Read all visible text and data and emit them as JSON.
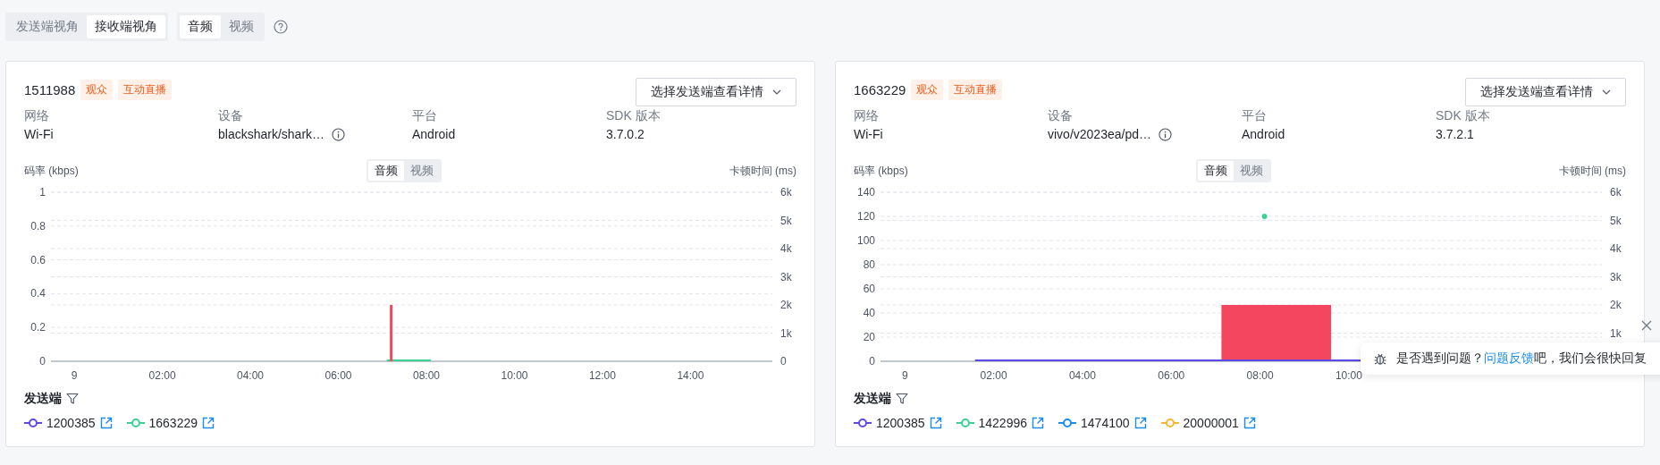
{
  "view_toggle": [
    {
      "label": "发送端视角",
      "selected": false
    },
    {
      "label": "接收端视角",
      "selected": true
    }
  ],
  "media_toggle": [
    {
      "label": "音频",
      "selected": true
    },
    {
      "label": "视频",
      "selected": false
    }
  ],
  "panels": [
    {
      "user_id": "1511988",
      "axis_start_label": "9",
      "tags": [
        "观众",
        "互动直播"
      ],
      "select_button": "选择发送端查看详情",
      "info": [
        {
          "label": "网络",
          "value": "Wi-Fi",
          "info_icon": false
        },
        {
          "label": "设备",
          "value": "blackshark/shark…",
          "info_icon": true
        },
        {
          "label": "平台",
          "value": "Android",
          "info_icon": false
        },
        {
          "label": "SDK 版本",
          "value": "3.7.0.2",
          "info_icon": false
        }
      ],
      "chart_toggle": [
        {
          "label": "音频",
          "selected": true
        },
        {
          "label": "视频",
          "selected": false
        }
      ],
      "chart_data": {
        "type": "line",
        "ylabel": "码率 (kbps)",
        "y2label": "卡顿时间 (ms)",
        "xlim": [
          -0.53,
          15.86
        ],
        "ylim": [
          0,
          1
        ],
        "y2lim": [
          0,
          6000
        ],
        "grid": true,
        "xticks": [
          {
            "value": 2,
            "label": "02:00"
          },
          {
            "value": 4,
            "label": "04:00"
          },
          {
            "value": 6,
            "label": "06:00"
          },
          {
            "value": 8,
            "label": "08:00"
          },
          {
            "value": 10,
            "label": "10:00"
          },
          {
            "value": 12,
            "label": "12:00"
          },
          {
            "value": 14,
            "label": "14:00"
          }
        ],
        "yticks": [
          {
            "value": 0,
            "label": "0"
          },
          {
            "value": 0.2,
            "label": "0.2"
          },
          {
            "value": 0.4,
            "label": "0.4"
          },
          {
            "value": 0.6,
            "label": "0.6"
          },
          {
            "value": 0.8,
            "label": "0.8"
          },
          {
            "value": 1,
            "label": "1"
          }
        ],
        "y2ticks": [
          {
            "value": 0,
            "label": "0"
          },
          {
            "value": 1000,
            "label": "1k"
          },
          {
            "value": 2000,
            "label": "2k"
          },
          {
            "value": 3000,
            "label": "3k"
          },
          {
            "value": 4000,
            "label": "4k"
          },
          {
            "value": 5000,
            "label": "5k"
          },
          {
            "value": 6000,
            "label": "6k"
          }
        ],
        "series": [
          {
            "color": "#3ad394",
            "type": "line",
            "x": [
              7.1,
              8.1
            ],
            "values": [
              0,
              0
            ]
          },
          {
            "color": "#f5465f",
            "type": "area",
            "axis": "y2",
            "x": [
              7.17,
              7.23
            ],
            "values": [
              2000,
              2000
            ]
          }
        ]
      },
      "legend_title": "发送端",
      "legend": [
        {
          "label": "1200385",
          "color": "#5b49e8"
        },
        {
          "label": "1663229",
          "color": "#3ad394"
        }
      ]
    },
    {
      "user_id": "1663229",
      "axis_start_label": "9",
      "tags": [
        "观众",
        "互动直播"
      ],
      "select_button": "选择发送端查看详情",
      "info": [
        {
          "label": "网络",
          "value": "Wi-Fi",
          "info_icon": false
        },
        {
          "label": "设备",
          "value": "vivo/v2023ea/pd…",
          "info_icon": true
        },
        {
          "label": "平台",
          "value": "Android",
          "info_icon": false
        },
        {
          "label": "SDK 版本",
          "value": "3.7.2.1",
          "info_icon": false
        }
      ],
      "chart_toggle": [
        {
          "label": "音频",
          "selected": true
        },
        {
          "label": "视频",
          "selected": false
        }
      ],
      "chart_data": {
        "type": "line",
        "ylabel": "码率 (kbps)",
        "y2label": "卡顿时间 (ms)",
        "xlim": [
          -0.55,
          15.7
        ],
        "ylim": [
          0,
          140
        ],
        "y2lim": [
          0,
          6000
        ],
        "grid": true,
        "xticks": [
          {
            "value": 2,
            "label": "02:00"
          },
          {
            "value": 4,
            "label": "04:00"
          },
          {
            "value": 6,
            "label": "06:00"
          },
          {
            "value": 8,
            "label": "08:00"
          },
          {
            "value": 10,
            "label": "10:00"
          }
        ],
        "yticks": [
          {
            "value": 0,
            "label": "0"
          },
          {
            "value": 20,
            "label": "20"
          },
          {
            "value": 40,
            "label": "40"
          },
          {
            "value": 60,
            "label": "60"
          },
          {
            "value": 80,
            "label": "80"
          },
          {
            "value": 100,
            "label": "100"
          },
          {
            "value": 120,
            "label": "120"
          },
          {
            "value": 140,
            "label": "140"
          }
        ],
        "y2ticks": [
          {
            "value": 1000,
            "label": "1k"
          },
          {
            "value": 2000,
            "label": "2k"
          },
          {
            "value": 3000,
            "label": "3k"
          },
          {
            "value": 4000,
            "label": "4k"
          },
          {
            "value": 5000,
            "label": "5k"
          },
          {
            "value": 6000,
            "label": "6k"
          }
        ],
        "series": [
          {
            "color": "#f5465f",
            "type": "area",
            "axis": "y2",
            "x": [
              7.13,
              9.6
            ],
            "values": [
              2000,
              2000
            ]
          },
          {
            "color": "#5b49e8",
            "type": "line",
            "x": [
              1.58,
              10.3
            ],
            "values": [
              0,
              0
            ]
          },
          {
            "color": "#3ad394",
            "type": "scatter",
            "x": [
              8.1
            ],
            "values": [
              120
            ]
          }
        ]
      },
      "legend_title": "发送端",
      "legend": [
        {
          "label": "1200385",
          "color": "#5b49e8"
        },
        {
          "label": "1422996",
          "color": "#3ad394"
        },
        {
          "label": "1474100",
          "color": "#1b8cf0"
        },
        {
          "label": "20000001",
          "color": "#f7b731"
        }
      ]
    }
  ],
  "feedback": {
    "text": "是否遇到问题？",
    "link": "问题反馈",
    "tail": "吧，我们会很快回复"
  }
}
